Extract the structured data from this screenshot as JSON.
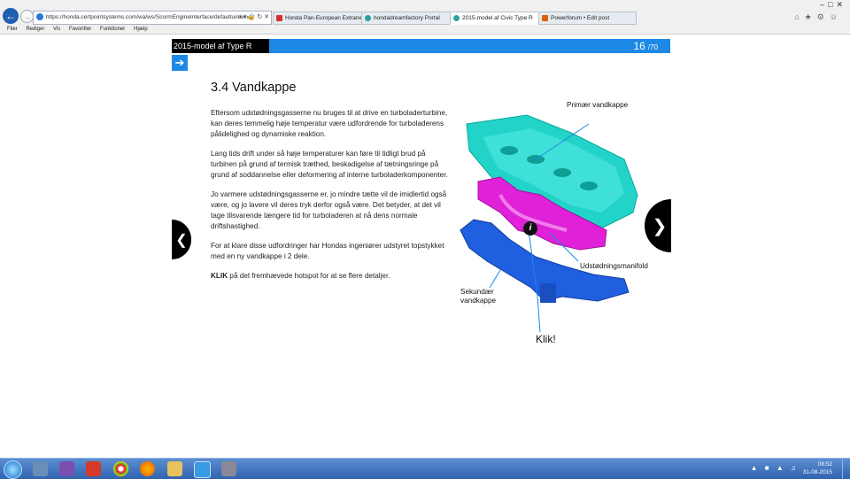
{
  "browser": {
    "address": "https://honda.certpointsystems.com/wa/ws/ScormEngineInterface/defaultui/deliver",
    "address_domain": "honda.certpointsystems.com",
    "tabs": [
      {
        "label": "Honda Pan-European Extranet",
        "color": "#d32f2f"
      },
      {
        "label": "hondadreamfactory Portal",
        "color": "#2aa0a0"
      },
      {
        "label": "2015-model af Civic Type R",
        "color": "#2aa0a0"
      },
      {
        "label": "Powerforum • Edit post",
        "color": "#e06000"
      }
    ],
    "menu": [
      "Filer",
      "Rediger",
      "Vis",
      "Favoritter",
      "Funktioner",
      "Hjælp"
    ]
  },
  "course": {
    "title": "2015-model af Type R",
    "page_current": "16",
    "page_total": "/70",
    "accent_color": "#1e88e5"
  },
  "content": {
    "heading": "3.4 Vandkappe",
    "paragraphs": [
      "Eftersom udstødningsgasserne nu bruges til at drive en turboladerturbine, kan deres temmelig høje temperatur være udfordrende for turboladerens pålidelighed og dynamiske reaktion.",
      "Lang tids drift under så høje temperaturer kan føre til tidligt brud på turbinen på grund af termisk træthed, beskadigelse af tætningsringe på grund af soddannelse eller deformering af interne turboladerkomponenter.",
      "Jo varmere udstødningsgasserne er, jo mindre tætte vil de imidlertid også være, og jo lavere vil deres tryk derfor også være. Det betyder, at det vil tage tilsvarende længere tid for turboladeren at nå dens normale driftshastighed.",
      "For at klare disse udfordringer har Hondas ingeniører udstyret topstykket med en ny vandkappe i 2 dele."
    ],
    "click_bold": "KLIK",
    "click_rest": " på det fremhævede hotspot for at se flere detaljer."
  },
  "diagram": {
    "label_primary": "Primær vandkappe",
    "label_manifold": "Udstødningsmanifold",
    "label_secondary_1": "Sekundær",
    "label_secondary_2": "vandkappe",
    "label_klik": "Klik!",
    "colors": {
      "primary": "#22d3c8",
      "manifold": "#e021d8",
      "secondary": "#1f5fe0"
    }
  },
  "taskbar": {
    "time": "08:52",
    "date": "31-08-2015"
  }
}
